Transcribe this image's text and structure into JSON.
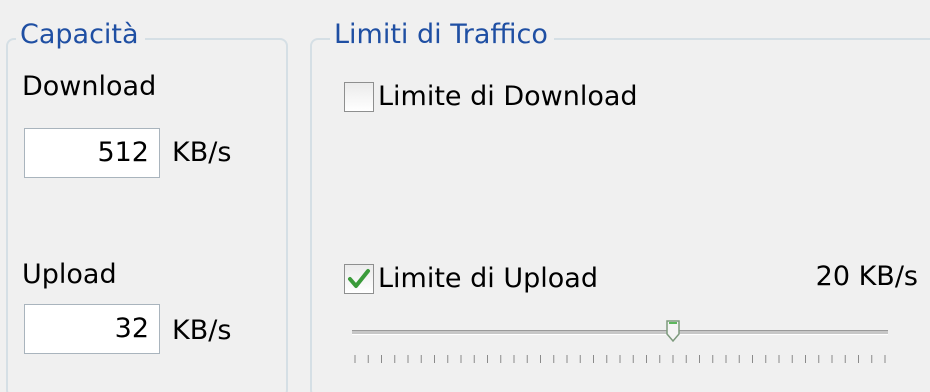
{
  "capacity": {
    "title": "Capacità",
    "download_label": "Download",
    "download_value": "512",
    "download_unit": "KB/s",
    "upload_label": "Upload",
    "upload_value": "32",
    "upload_unit": "KB/s"
  },
  "traffic_limits": {
    "title": "Limiti di Traffico",
    "download_limit": {
      "label": "Limite di Download",
      "checked": false
    },
    "upload_limit": {
      "label": "Limite di Upload",
      "checked": true,
      "value_text": "20 KB/s",
      "slider_fraction": 0.6
    }
  },
  "colors": {
    "group_title": "#1f4fa3",
    "checkmark": "#3a9b3a"
  }
}
